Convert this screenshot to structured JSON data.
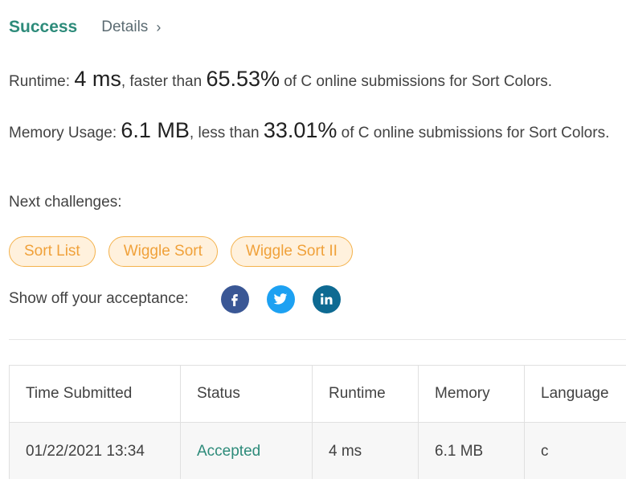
{
  "header": {
    "status": "Success",
    "details_label": "Details",
    "chevron": "›"
  },
  "runtime": {
    "label": "Runtime: ",
    "value": "4 ms",
    "mid": ", faster than ",
    "percent": "65.53%",
    "tail": " of C online submissions for Sort Colors."
  },
  "memory": {
    "label": "Memory Usage: ",
    "value": "6.1 MB",
    "mid": ", less than ",
    "percent": "33.01%",
    "tail": " of C online submissions for Sort Colors."
  },
  "next": {
    "label": "Next challenges:",
    "challenges": [
      "Sort List",
      "Wiggle Sort",
      "Wiggle Sort II"
    ]
  },
  "share": {
    "label": "Show off your acceptance:",
    "icons": [
      "facebook-icon",
      "twitter-icon",
      "linkedin-icon"
    ]
  },
  "table": {
    "headers": [
      "Time Submitted",
      "Status",
      "Runtime",
      "Memory",
      "Language"
    ],
    "rows": [
      [
        "01/22/2021 13:34",
        "Accepted",
        "4 ms",
        "6.1 MB",
        "c"
      ]
    ]
  },
  "colors": {
    "success": "#2d8b7a",
    "chip_border": "#f4b24c",
    "chip_bg": "#fff1dd",
    "chip_text": "#f0a13a",
    "facebook": "#3a5795",
    "twitter": "#1da1f2",
    "linkedin": "#0e6a92"
  }
}
